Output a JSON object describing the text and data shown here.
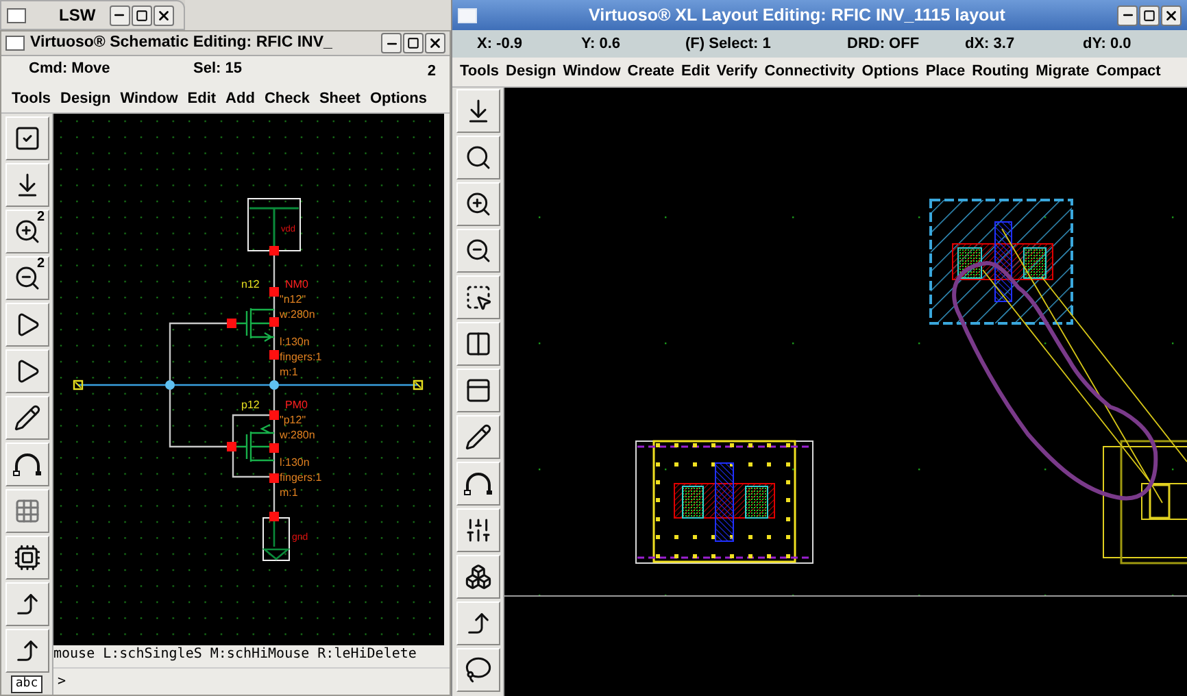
{
  "lsw_window": {
    "title": "LSW"
  },
  "schematic_window": {
    "title": "Virtuoso® Schematic Editing: RFIC INV_",
    "command": "Cmd: Move",
    "selection": "Sel: 15",
    "count": "2",
    "menu": [
      "Tools",
      "Design",
      "Window",
      "Edit",
      "Add",
      "Check",
      "Sheet",
      "Options"
    ],
    "toolbar": [
      {
        "kind": "check"
      },
      {
        "kind": "load"
      },
      {
        "kind": "zoomin",
        "badge": "2"
      },
      {
        "kind": "zoomout",
        "badge": "2"
      },
      {
        "kind": "gatehatch"
      },
      {
        "kind": "gate"
      },
      {
        "kind": "pen"
      },
      {
        "kind": "arc"
      },
      {
        "kind": "grid"
      },
      {
        "kind": "chip"
      },
      {
        "kind": "step"
      },
      {
        "kind": "stepdot"
      }
    ],
    "schematic": {
      "instances": [
        {
          "cell": "n12",
          "name": "NM0",
          "params": [
            "\"n12\"",
            "w:280n",
            "l:130n",
            "fingers:1",
            "m:1"
          ]
        },
        {
          "cell": "p12",
          "name": "PM0",
          "params": [
            "\"p12\"",
            "w:280n",
            "l:130n",
            "fingers:1",
            "m:1"
          ]
        }
      ],
      "supplies": [
        "vdd",
        "gnd"
      ]
    },
    "message": "mouse L:schSingleS M:schHiMouse R:leHiDelete",
    "prompt": ">",
    "footer_label": "abc"
  },
  "layout_window": {
    "title": "Virtuoso® XL Layout Editing: RFIC INV_1115 layout",
    "status": [
      "X: -0.9",
      "Y:  0.6",
      "(F) Select: 1",
      "DRD: OFF",
      "dX:  3.7",
      "dY:  0.0"
    ],
    "menu": [
      "Tools",
      "Design",
      "Window",
      "Create",
      "Edit",
      "Verify",
      "Connectivity",
      "Options",
      "Place",
      "Routing",
      "Migrate",
      "Compact"
    ],
    "toolbar": [
      {
        "kind": "load"
      },
      {
        "kind": "zoomselect"
      },
      {
        "kind": "zoomin"
      },
      {
        "kind": "zoomout"
      },
      {
        "kind": "frame"
      },
      {
        "kind": "columns"
      },
      {
        "kind": "rows"
      },
      {
        "kind": "pen"
      },
      {
        "kind": "arc"
      },
      {
        "kind": "sliders"
      },
      {
        "kind": "cluster"
      },
      {
        "kind": "step"
      },
      {
        "kind": "shape"
      }
    ]
  }
}
